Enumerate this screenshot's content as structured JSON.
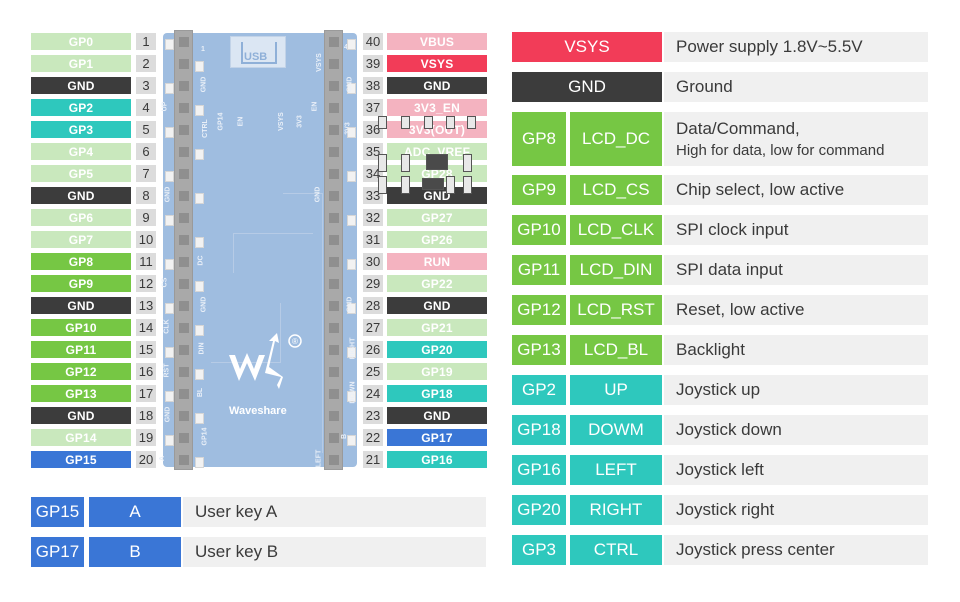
{
  "colors": {
    "gpio_light": "#c9e8bd",
    "gnd": "#3c3c3c",
    "lcd_green": "#76c744",
    "joystick_teal": "#2ec8bd",
    "key_blue": "#3a76d6",
    "power_pink": "#f4b3c0",
    "vsys_red": "#f23c58",
    "num_bg": "#dcdcdc",
    "desc_bg": "#f0f0f0"
  },
  "left_pins": [
    {
      "num": "1",
      "label": "GP0",
      "type": "gpio_light"
    },
    {
      "num": "2",
      "label": "GP1",
      "type": "gpio_light"
    },
    {
      "num": "3",
      "label": "GND",
      "type": "gnd"
    },
    {
      "num": "4",
      "label": "GP2",
      "type": "joystick_teal"
    },
    {
      "num": "5",
      "label": "GP3",
      "type": "joystick_teal"
    },
    {
      "num": "6",
      "label": "GP4",
      "type": "gpio_light"
    },
    {
      "num": "7",
      "label": "GP5",
      "type": "gpio_light"
    },
    {
      "num": "8",
      "label": "GND",
      "type": "gnd"
    },
    {
      "num": "9",
      "label": "GP6",
      "type": "gpio_light"
    },
    {
      "num": "10",
      "label": "GP7",
      "type": "gpio_light"
    },
    {
      "num": "11",
      "label": "GP8",
      "type": "lcd_green"
    },
    {
      "num": "12",
      "label": "GP9",
      "type": "lcd_green"
    },
    {
      "num": "13",
      "label": "GND",
      "type": "gnd"
    },
    {
      "num": "14",
      "label": "GP10",
      "type": "lcd_green"
    },
    {
      "num": "15",
      "label": "GP11",
      "type": "lcd_green"
    },
    {
      "num": "16",
      "label": "GP12",
      "type": "lcd_green"
    },
    {
      "num": "17",
      "label": "GP13",
      "type": "lcd_green"
    },
    {
      "num": "18",
      "label": "GND",
      "type": "gnd"
    },
    {
      "num": "19",
      "label": "GP14",
      "type": "gpio_light"
    },
    {
      "num": "20",
      "label": "GP15",
      "type": "key_blue"
    }
  ],
  "right_pins": [
    {
      "num": "40",
      "label": "VBUS",
      "type": "power_pink"
    },
    {
      "num": "39",
      "label": "VSYS",
      "type": "vsys_red"
    },
    {
      "num": "38",
      "label": "GND",
      "type": "gnd"
    },
    {
      "num": "37",
      "label": "3V3_EN",
      "type": "power_pink"
    },
    {
      "num": "36",
      "label": "3V3(OUT)",
      "type": "power_pink"
    },
    {
      "num": "35",
      "label": "ADC_VREF",
      "type": "gpio_light"
    },
    {
      "num": "34",
      "label": "GP28",
      "type": "gpio_light"
    },
    {
      "num": "33",
      "label": "GND",
      "type": "gnd"
    },
    {
      "num": "32",
      "label": "GP27",
      "type": "gpio_light"
    },
    {
      "num": "31",
      "label": "GP26",
      "type": "gpio_light"
    },
    {
      "num": "30",
      "label": "RUN",
      "type": "power_pink"
    },
    {
      "num": "29",
      "label": "GP22",
      "type": "gpio_light"
    },
    {
      "num": "28",
      "label": "GND",
      "type": "gnd"
    },
    {
      "num": "27",
      "label": "GP21",
      "type": "gpio_light"
    },
    {
      "num": "26",
      "label": "GP20",
      "type": "joystick_teal"
    },
    {
      "num": "25",
      "label": "GP19",
      "type": "gpio_light"
    },
    {
      "num": "24",
      "label": "GP18",
      "type": "joystick_teal"
    },
    {
      "num": "23",
      "label": "GND",
      "type": "gnd"
    },
    {
      "num": "22",
      "label": "GP17",
      "type": "key_blue"
    },
    {
      "num": "21",
      "label": "GP16",
      "type": "joystick_teal"
    }
  ],
  "board": {
    "usb_label": "USB",
    "pin1_label": "1",
    "pin40_label": "40",
    "brand": "Waveshare",
    "registered": "®",
    "left_outer_silk": [
      "UP",
      "GND",
      "CS",
      "CLK",
      "RST",
      "GND",
      "A"
    ],
    "left_inner_silk": [
      "GND",
      "CTRL",
      "DC",
      "GND",
      "DIN",
      "BL",
      "GP14"
    ],
    "right_inner_silk": [
      "VSYS",
      "EN",
      "GND",
      "LEFT"
    ],
    "right_outer_silk": [
      "GND",
      "3V3",
      "GND",
      "RIGHT",
      "DOWN",
      "B"
    ],
    "center_silk": [
      "GP14",
      "EN",
      "VSYS",
      "3V3"
    ]
  },
  "function_table": [
    {
      "pin": "",
      "name": "VSYS",
      "desc": "Power supply 1.8V~5.5V",
      "sub": "",
      "type": "vsys_red",
      "merged": true
    },
    {
      "pin": "",
      "name": "GND",
      "desc": "Ground",
      "sub": "",
      "type": "gnd",
      "merged": true
    },
    {
      "pin": "GP8",
      "name": "LCD_DC",
      "desc": "Data/Command,",
      "sub": "High for data, low for command",
      "type": "lcd_green",
      "merged": false
    },
    {
      "pin": "GP9",
      "name": "LCD_CS",
      "desc": "Chip select, low active",
      "sub": "",
      "type": "lcd_green",
      "merged": false
    },
    {
      "pin": "GP10",
      "name": "LCD_CLK",
      "desc": "SPI clock input",
      "sub": "",
      "type": "lcd_green",
      "merged": false
    },
    {
      "pin": "GP11",
      "name": "LCD_DIN",
      "desc": "SPI data input",
      "sub": "",
      "type": "lcd_green",
      "merged": false
    },
    {
      "pin": "GP12",
      "name": "LCD_RST",
      "desc": "Reset, low active",
      "sub": "",
      "type": "lcd_green",
      "merged": false
    },
    {
      "pin": "GP13",
      "name": "LCD_BL",
      "desc": "Backlight",
      "sub": "",
      "type": "lcd_green",
      "merged": false
    },
    {
      "pin": "GP2",
      "name": "UP",
      "desc": "Joystick up",
      "sub": "",
      "type": "joystick_teal",
      "merged": false
    },
    {
      "pin": "GP18",
      "name": "DOWM",
      "desc": "Joystick down",
      "sub": "",
      "type": "joystick_teal",
      "merged": false
    },
    {
      "pin": "GP16",
      "name": "LEFT",
      "desc": "Joystick left",
      "sub": "",
      "type": "joystick_teal",
      "merged": false
    },
    {
      "pin": "GP20",
      "name": "RIGHT",
      "desc": "Joystick right",
      "sub": "",
      "type": "joystick_teal",
      "merged": false
    },
    {
      "pin": "GP3",
      "name": "CTRL",
      "desc": "Joystick press center",
      "sub": "",
      "type": "joystick_teal",
      "merged": false
    }
  ],
  "key_table": [
    {
      "pin": "GP15",
      "name": "A",
      "desc": "User key A",
      "type": "key_blue"
    },
    {
      "pin": "GP17",
      "name": "B",
      "desc": "User key B",
      "type": "key_blue"
    }
  ]
}
